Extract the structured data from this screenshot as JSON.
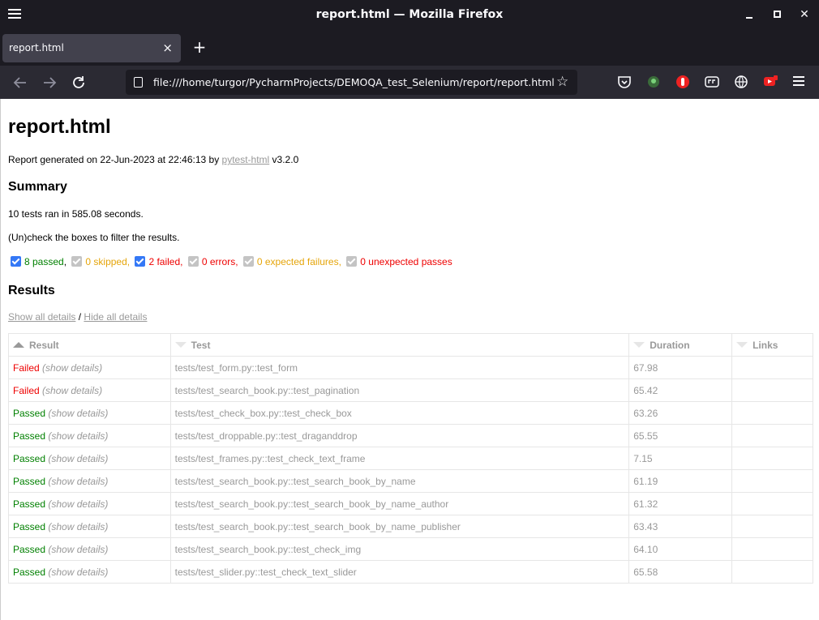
{
  "window": {
    "title": "report.html — Mozilla Firefox",
    "min": "_",
    "close": "✕"
  },
  "tab": {
    "label": "report.html",
    "close": "×"
  },
  "newtab": "+",
  "url": "file:///home/turgor/PycharmProjects/DEMOQA_test_Selenium/report/report.html",
  "star": "☆",
  "page": {
    "title": "report.html",
    "generated_prefix": "Report generated on 22-Jun-2023 at 22:46:13 by ",
    "generated_link": "pytest-html",
    "generated_suffix": " v3.2.0",
    "summary_heading": "Summary",
    "ran": "10 tests ran in 585.08 seconds.",
    "uncheck": "(Un)check the boxes to filter the results.",
    "filters": [
      {
        "label": "8 passed",
        "sep": ",",
        "checked": true,
        "color": "green"
      },
      {
        "label": "0 skipped",
        "sep": ",",
        "checked": false,
        "color": "orange"
      },
      {
        "label": "2 failed",
        "sep": ",",
        "checked": true,
        "color": "red"
      },
      {
        "label": "0 errors",
        "sep": ",",
        "checked": false,
        "color": "red"
      },
      {
        "label": "0 expected failures",
        "sep": ",",
        "checked": false,
        "color": "orange"
      },
      {
        "label": "0 unexpected passes",
        "sep": "",
        "checked": false,
        "color": "red"
      }
    ],
    "results_heading": "Results",
    "show_all": "Show all details",
    "slash": " / ",
    "hide_all": "Hide all details",
    "columns": [
      "Result",
      "Test",
      "Duration",
      "Links"
    ],
    "rows": [
      {
        "result": "Failed",
        "details": "(show details)",
        "test": "tests/test_form.py::test_form",
        "duration": "67.98"
      },
      {
        "result": "Failed",
        "details": "(show details)",
        "test": "tests/test_search_book.py::test_pagination",
        "duration": "65.42"
      },
      {
        "result": "Passed",
        "details": "(show details)",
        "test": "tests/test_check_box.py::test_check_box",
        "duration": "63.26"
      },
      {
        "result": "Passed",
        "details": "(show details)",
        "test": "tests/test_droppable.py::test_draganddrop",
        "duration": "65.55"
      },
      {
        "result": "Passed",
        "details": "(show details)",
        "test": "tests/test_frames.py::test_check_text_frame",
        "duration": "7.15"
      },
      {
        "result": "Passed",
        "details": "(show details)",
        "test": "tests/test_search_book.py::test_search_book_by_name",
        "duration": "61.19"
      },
      {
        "result": "Passed",
        "details": "(show details)",
        "test": "tests/test_search_book.py::test_search_book_by_name_author",
        "duration": "61.32"
      },
      {
        "result": "Passed",
        "details": "(show details)",
        "test": "tests/test_search_book.py::test_search_book_by_name_publisher",
        "duration": "63.43"
      },
      {
        "result": "Passed",
        "details": "(show details)",
        "test": "tests/test_search_book.py::test_check_img",
        "duration": "64.10"
      },
      {
        "result": "Passed",
        "details": "(show details)",
        "test": "tests/test_slider.py::test_check_text_slider",
        "duration": "65.58"
      }
    ]
  },
  "colors": {
    "chrome": "#1c1b22",
    "toolbar": "#2b2a33",
    "passed": "#008000",
    "failed": "#e00",
    "checkbox": "#3478f6"
  }
}
